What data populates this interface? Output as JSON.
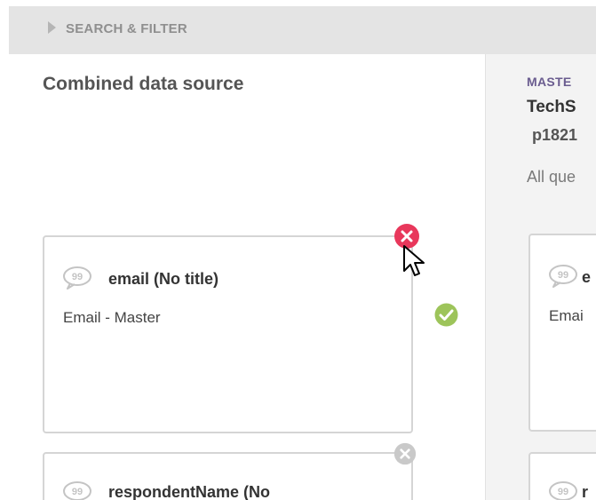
{
  "filter_bar": {
    "label": "SEARCH & FILTER",
    "arrow_icon": "caret-right-icon"
  },
  "left_column": {
    "title": "Combined data source",
    "cards": [
      {
        "title": "email (No title)",
        "subtitle": "Email - Master",
        "icon": "speech-bubble-icon",
        "remove_icon": "remove-icon",
        "remove_state": "hover",
        "remove_color": "#e8375b",
        "status_icon": "checkmark-icon",
        "status_color": "#9dc45a"
      },
      {
        "title": "respondentName (No",
        "subtitle": "",
        "icon": "speech-bubble-icon",
        "remove_icon": "remove-icon",
        "remove_state": "normal",
        "remove_color": "#c9c9c9"
      }
    ]
  },
  "right_column": {
    "master_label": "MASTE",
    "source_name": "TechS",
    "source_id": "p1821",
    "all_questions": "All que",
    "cards": [
      {
        "title_fragment": "e",
        "subtitle_fragment": "Emai",
        "icon": "speech-bubble-icon"
      },
      {
        "title_fragment": "r",
        "icon": "speech-bubble-icon"
      }
    ]
  },
  "colors": {
    "filter_bar_bg": "#e4e4e4",
    "master_label": "#6a5c8f",
    "card_border": "#d5d5d5",
    "remove_hover": "#e8375b",
    "check_ok": "#9dc45a"
  }
}
